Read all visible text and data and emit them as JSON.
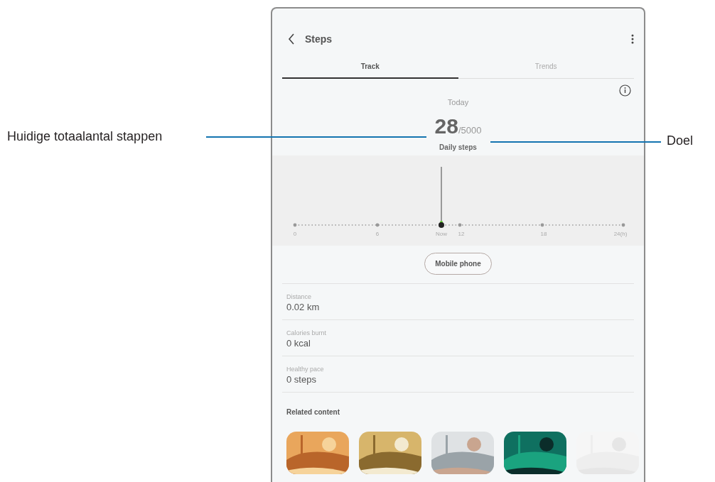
{
  "callouts": [
    {
      "label": "Huidige totaalantal stappen"
    },
    {
      "label": "Doel"
    }
  ],
  "header": {
    "title": "Steps"
  },
  "tabs": [
    {
      "label": "Track",
      "selected": true
    },
    {
      "label": "Trends",
      "selected": false
    }
  ],
  "summary": {
    "period": "Today",
    "steps": "28",
    "goal": "/5000",
    "caption": "Daily steps"
  },
  "chart": {
    "axis_labels": [
      "0",
      "6",
      "Now",
      "12",
      "18",
      "24(h)"
    ]
  },
  "source_button": "Mobile phone",
  "stats": [
    {
      "label": "Distance",
      "value": "0.02 km"
    },
    {
      "label": "Calories burnt",
      "value": "0 kcal"
    },
    {
      "label": "Healthy pace",
      "value": "0 steps"
    }
  ],
  "related": {
    "title": "Related content"
  }
}
